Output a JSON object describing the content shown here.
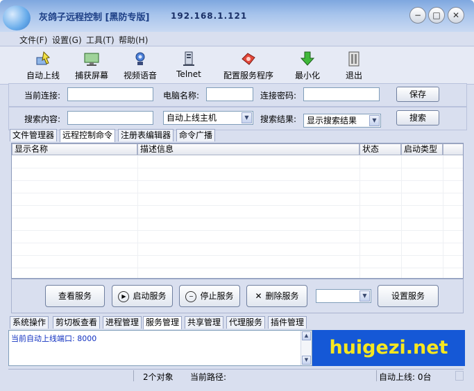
{
  "window": {
    "title": "灰鸽子远程控制 [黑防专版]",
    "ip": "192.168.1.121",
    "minimize_glyph": "−",
    "maximize_glyph": "□",
    "close_glyph": "✕"
  },
  "menu": [
    "文件(F)",
    "设置(G)",
    "工具(T)",
    "帮助(H)"
  ],
  "toolbar": [
    {
      "label": "自动上线",
      "icon": "auto-online-icon"
    },
    {
      "label": "捕获屏幕",
      "icon": "screen-capture-icon"
    },
    {
      "label": "视频语音",
      "icon": "video-voice-icon"
    },
    {
      "label": "Telnet",
      "icon": "telnet-icon"
    },
    {
      "label": "配置服务程序",
      "icon": "config-server-icon"
    },
    {
      "label": "最小化",
      "icon": "minimize-icon"
    },
    {
      "label": "退出",
      "icon": "exit-icon"
    }
  ],
  "connection": {
    "current_label": "当前连接:",
    "current_value": "",
    "pc_name_label": "电脑名称:",
    "pc_name_value": "",
    "password_label": "连接密码:",
    "password_value": "",
    "save_label": "保存"
  },
  "search": {
    "content_label": "搜索内容:",
    "content_value": "",
    "scope_selected": "自动上线主机",
    "result_label": "搜索结果:",
    "result_selected": "显示搜索结果",
    "search_label": "搜索"
  },
  "main_tabs": [
    "文件管理器",
    "远程控制命令",
    "注册表编辑器",
    "命令广播"
  ],
  "list_columns": [
    "显示名称",
    "描述信息",
    "状态",
    "启动类型"
  ],
  "actions": {
    "view": "查看服务",
    "start": "启动服务",
    "stop": "停止服务",
    "delete": "删除服务",
    "dropdown_selected": "",
    "set": "设置服务"
  },
  "sub_tabs": [
    "系统操作",
    "剪切板查看",
    "进程管理",
    "服务管理",
    "共享管理",
    "代理服务",
    "插件管理"
  ],
  "log": {
    "text": "当前自动上线端口: 8000"
  },
  "banner": {
    "text": "huigezi.net"
  },
  "status": {
    "objects": "2个对象",
    "path_label": "当前路径:",
    "online": "自动上线: 0台"
  },
  "colors": {
    "banner_bg": "#1558d6",
    "banner_text": "#f6e71f",
    "log_text": "#1030c0"
  }
}
